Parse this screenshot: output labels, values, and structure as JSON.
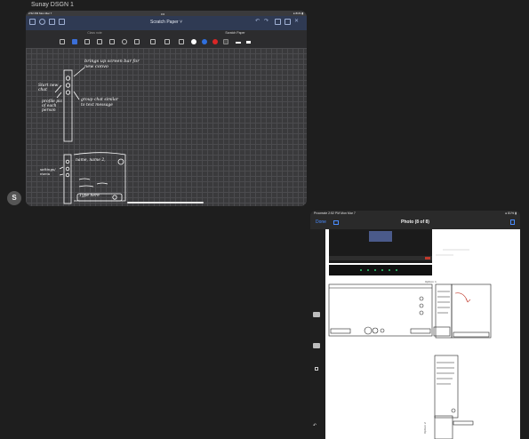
{
  "session": {
    "title": "Sunay DSGN 1"
  },
  "avatar": {
    "letter": "S"
  },
  "ipad1": {
    "status_left": "2:52 PM  Mon Mar 7",
    "status_right": "● 81% ▮",
    "doc_title": "Scratch Paper ˅",
    "tabs": [
      "Class note",
      "Scratch Paper"
    ],
    "swatches": [
      "#ffffff",
      "#2f6fde",
      "#d92626"
    ]
  },
  "ipad2": {
    "status_left": "Procreate  2:52 PM  Mon Mar 7",
    "status_right": "● 81% ▮",
    "done": "Done",
    "title": "Photo (8 of 8)"
  },
  "sketch": {
    "label_start_chat": "Start new chat",
    "label_profile": "profile pic of each person",
    "label_brings_up": "brings up screen bar for new convo",
    "label_group_chat": "group chat similar to text message",
    "label_name_typing": "name, name 2,",
    "label_type_here": "Type here",
    "label_settings": "settings/ menu"
  }
}
